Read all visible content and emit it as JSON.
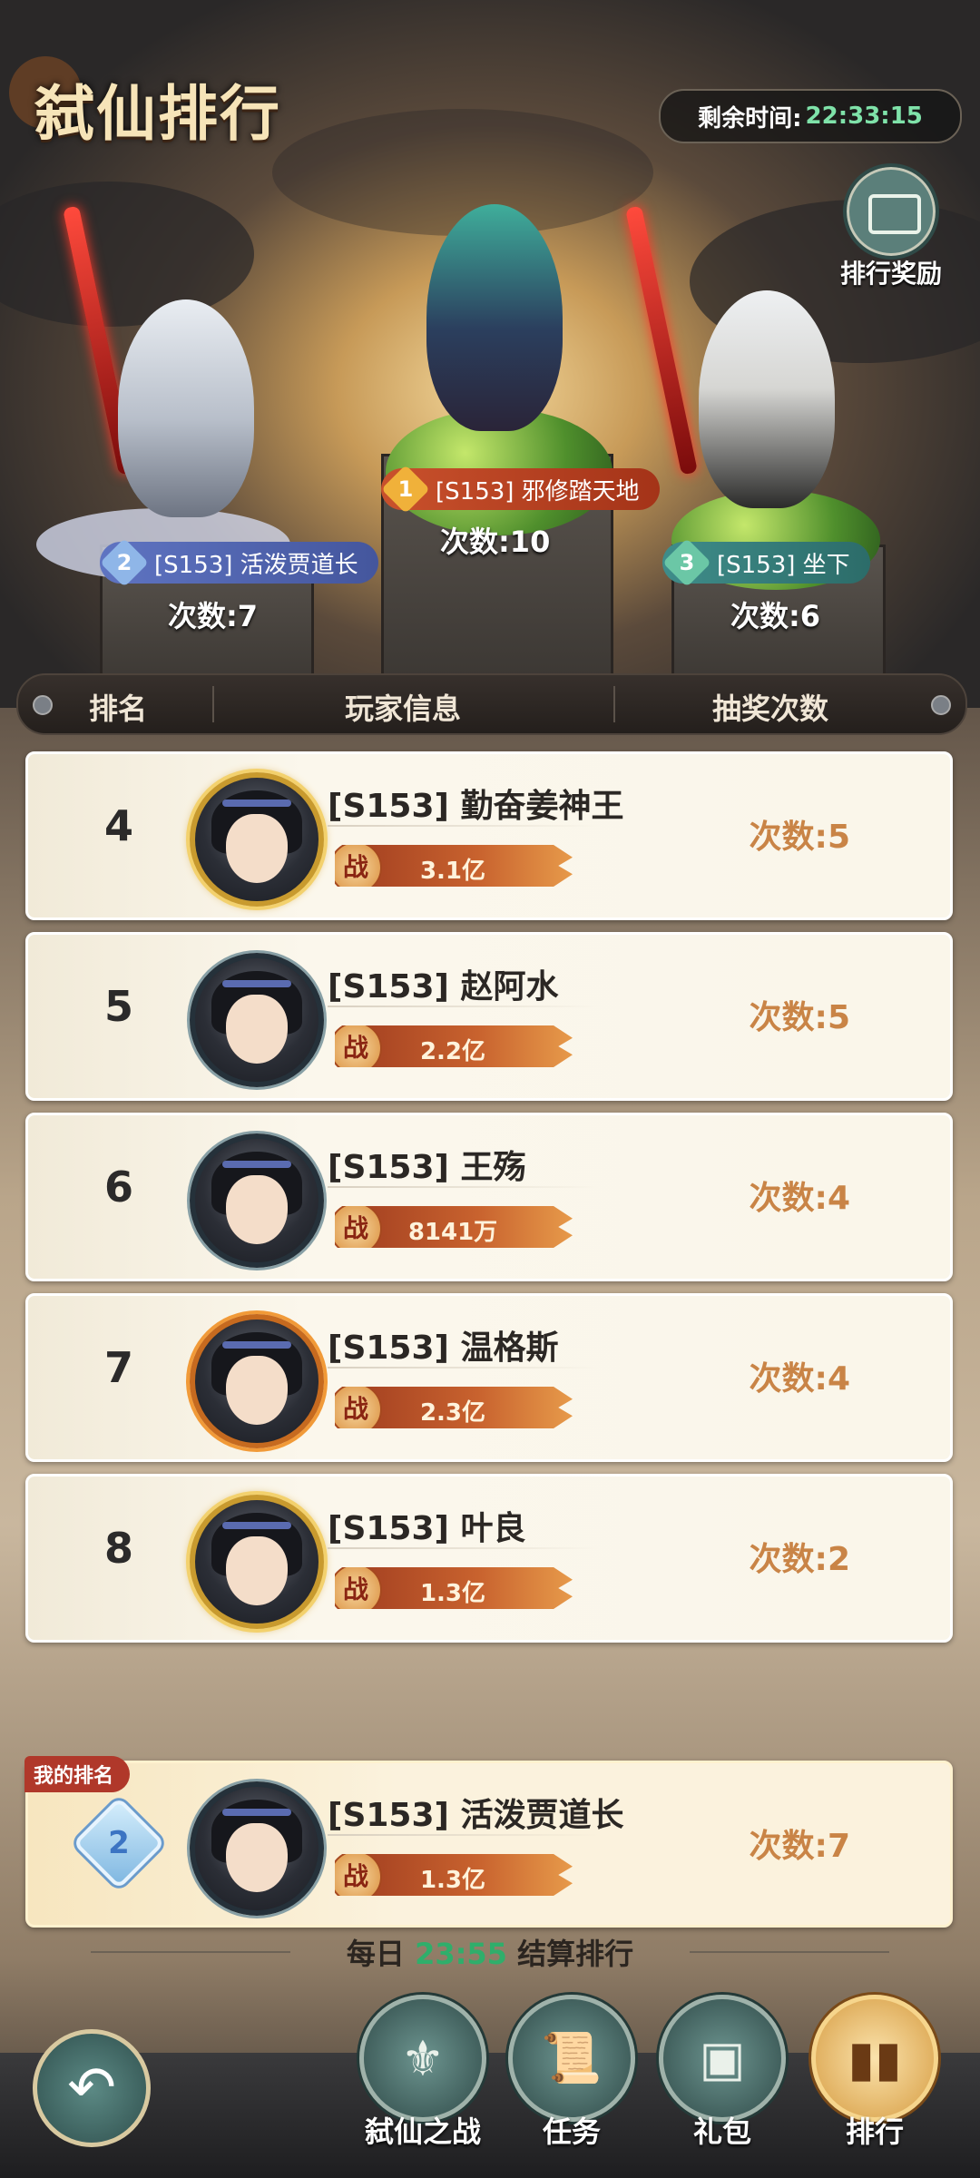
{
  "title": "弑仙排行",
  "timer": {
    "label": "剩余时间:",
    "value": "22:33:15"
  },
  "reward_button": {
    "label": "排行奖励"
  },
  "podium": [
    {
      "rank": "1",
      "name": "[S153] 邪修踏天地",
      "count": "次数:10"
    },
    {
      "rank": "2",
      "name": "[S153] 活泼贾道长",
      "count": "次数:7"
    },
    {
      "rank": "3",
      "name": "[S153] 坐下",
      "count": "次数:6"
    }
  ],
  "table_header": {
    "rank": "排名",
    "player": "玩家信息",
    "draws": "抽奖次数"
  },
  "rows": [
    {
      "rank": "4",
      "name": "[S153] 勤奋姜神王",
      "power": "3.1亿",
      "count": "次数:5",
      "frame": "gold"
    },
    {
      "rank": "5",
      "name": "[S153] 赵阿水",
      "power": "2.2亿",
      "count": "次数:5",
      "frame": "plain"
    },
    {
      "rank": "6",
      "name": "[S153] 王殇",
      "power": "8141万",
      "count": "次数:4",
      "frame": "plain"
    },
    {
      "rank": "7",
      "name": "[S153] 温格斯",
      "power": "2.3亿",
      "count": "次数:4",
      "frame": "autumn"
    },
    {
      "rank": "8",
      "name": "[S153] 叶良",
      "power": "1.3亿",
      "count": "次数:2",
      "frame": "gold"
    }
  ],
  "power_glyph": "战",
  "my_rank": {
    "tag": "我的排名",
    "rank": "2",
    "name": "[S153] 活泼贾道长",
    "power": "1.3亿",
    "count": "次数:7"
  },
  "settle": {
    "prefix": "每日",
    "time": "23:55",
    "suffix": "结算排行"
  },
  "nav": [
    {
      "label": "弑仙之战",
      "icon": "battle-emblem-icon"
    },
    {
      "label": "任务",
      "icon": "scroll-icon"
    },
    {
      "label": "礼包",
      "icon": "chest-icon"
    },
    {
      "label": "排行",
      "icon": "bar-chart-icon"
    }
  ],
  "back_icon": "back-arrow-icon"
}
